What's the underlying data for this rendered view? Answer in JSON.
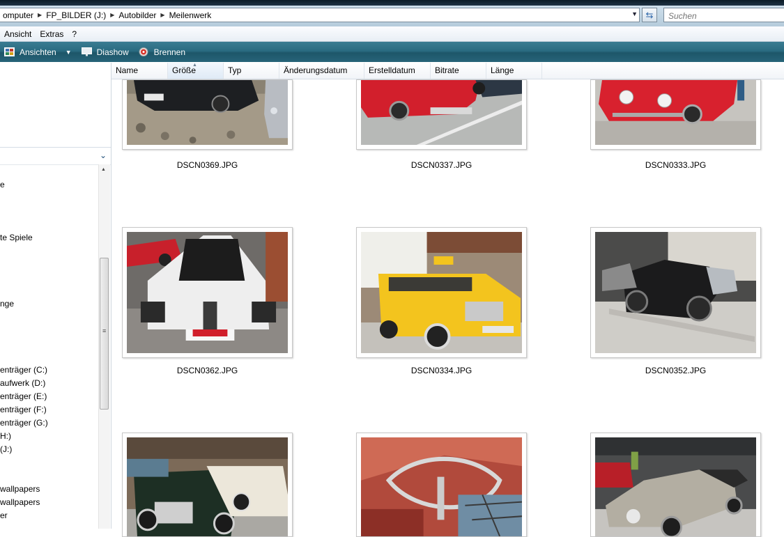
{
  "breadcrumb": [
    "omputer",
    "FP_BILDER (J:)",
    "Autobilder",
    "Meilenwerk"
  ],
  "search": {
    "placeholder": "Suchen"
  },
  "menu": [
    "Ansicht",
    "Extras",
    "?"
  ],
  "toolbar": {
    "views": "Ansichten",
    "slideshow": "Diashow",
    "burn": "Brennen"
  },
  "columns": [
    "Name",
    "Größe",
    "Typ",
    "Änderungsdatum",
    "Erstelldatum",
    "Bitrate",
    "Länge"
  ],
  "nav": {
    "items": [
      "e",
      "te Spiele",
      "nge",
      "enträger (C:)",
      "aufwerk (D:)",
      "enträger (E:)",
      "enträger (F:)",
      "enträger (G:)",
      "H:)",
      "(J:)",
      "wallpapers",
      "wallpapers",
      "er"
    ]
  },
  "files": [
    {
      "name": "DSCN0369.JPG"
    },
    {
      "name": "DSCN0337.JPG"
    },
    {
      "name": "DSCN0333.JPG"
    },
    {
      "name": "DSCN0362.JPG"
    },
    {
      "name": "DSCN0334.JPG"
    },
    {
      "name": "DSCN0352.JPG"
    },
    {
      "name": ""
    },
    {
      "name": ""
    },
    {
      "name": ""
    }
  ],
  "colors": {
    "toolbar": "#2a6b81",
    "accent": "#1f4e79"
  }
}
